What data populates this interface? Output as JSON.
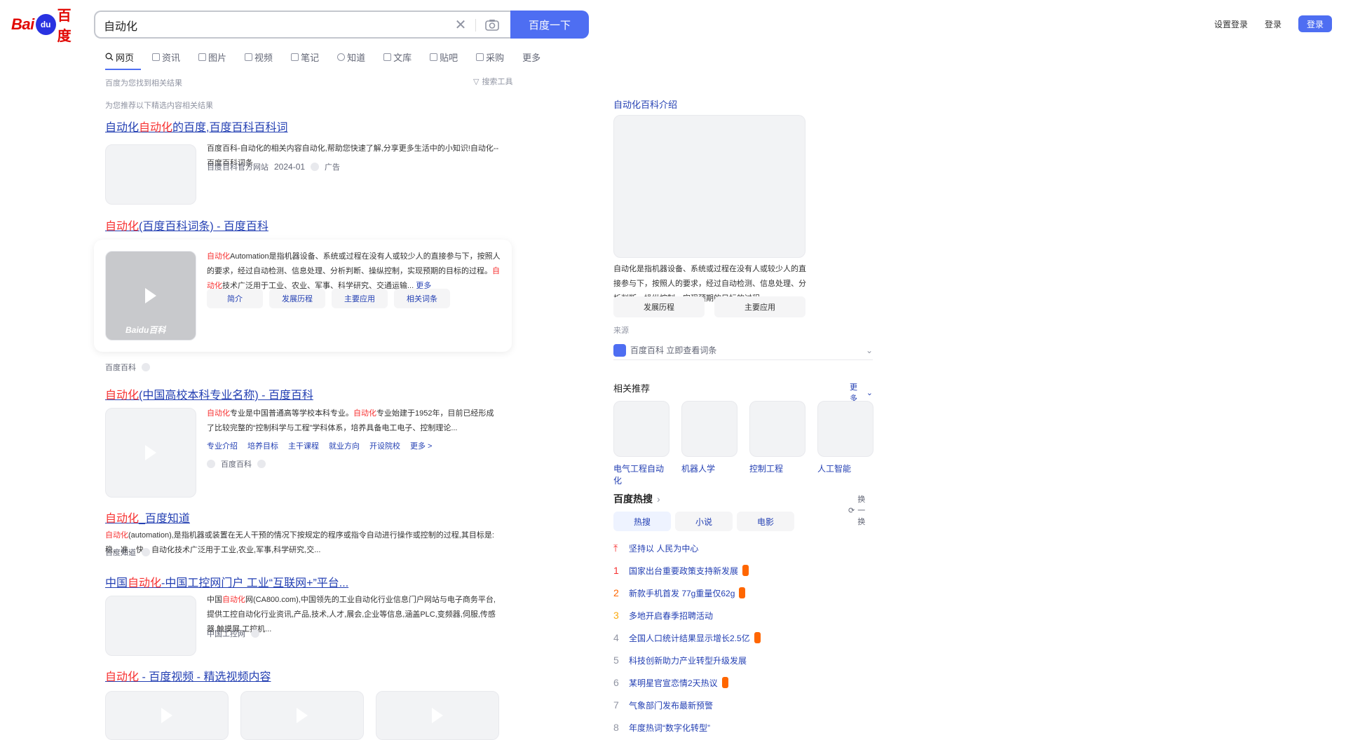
{
  "header": {
    "logo_text_left": "Bai",
    "logo_paw": "du",
    "logo_text_right": "百度",
    "search_value": "自动化",
    "search_button": "百度一下",
    "top_links": [
      "设置登录",
      "登录"
    ],
    "login_button": "登录"
  },
  "tabs": [
    {
      "label": "网页",
      "active": true
    },
    {
      "label": "资讯"
    },
    {
      "label": "图片"
    },
    {
      "label": "视频"
    },
    {
      "label": "笔记"
    },
    {
      "label": "知道"
    },
    {
      "label": "文库"
    },
    {
      "label": "贴吧"
    },
    {
      "label": "采购"
    },
    {
      "label": "更多"
    }
  ],
  "result_count": "百度为您找到相关结果",
  "tools_label": "搜索工具",
  "hint": "为您推荐以下精选内容相关结果",
  "results": {
    "r1": {
      "title_pre": "自动化",
      "title_em": "自动化",
      "title_post": "的百度,百度百科百科词",
      "text": "百度百科-自动化的相关内容自动化,帮助您快速了解,分享更多生活中的小知识!自动化--百度百科词条",
      "source": "百度百科官方网站",
      "date": "2024-01",
      "ad": "广告"
    },
    "r2": {
      "title_em": "自动化",
      "title_post": "(百度百科词条) - 百度百科",
      "text_em": "自动化",
      "text_mid": "Automation",
      "text_rest": "是指机器设备、系统或过程在没有人或较少人的直接参与下，按照人的要求，经过自动检测、信息处理、分析判断、操纵控制，实现预期的目标的过程。",
      "text2_em": "自动化",
      "text2_rest": "技术广泛用于工业、农业、军事、科学研究、交通运输...",
      "more": "更多",
      "buttons": [
        "简介",
        "发展历程",
        "主要应用",
        "相关词条"
      ],
      "source": "百度百科",
      "watermark": "Baidu百科"
    },
    "r3": {
      "title_em": "自动化",
      "title_post": "(中国高校本科专业名称) - 百度百科",
      "text_em": "自动化",
      "text_mid": "专业是中国普通高等学校本科专业。",
      "text2_em": "自动化",
      "text_rest": "专业始建于1952年，目前已经形成了比较完整的“控制科学与工程”学科体系，培养具备电工电子、控制理论...",
      "links": [
        "专业介绍",
        "培养目标",
        "主干课程",
        "就业方向",
        "开设院校",
        "更多 >"
      ],
      "source": "百度百科"
    },
    "r4": {
      "title_em": "自动化",
      "title_post": "_百度知道",
      "text_em": "自动化",
      "text_rest": "(automation),是指机器或装置在无人干预的情况下按规定的程序或指令自动进行操作或控制的过程,其目标是:稳、准、快。自动化技术广泛用于工业,农业,军事,科学研究,交...",
      "source": "百度知道"
    },
    "r5": {
      "title_pre": "中国",
      "title_em": "自动化",
      "title_post": "-中国工控网门户 工业“互联网+”平台...",
      "text_pre": "中国",
      "text_em": "自动化",
      "text_rest": "网(CA800.com),中国领先的工业自动化行业信息门户网站与电子商务平台,提供工控自动化行业资讯,产品,技术,人才,展会,企业等信息,涵盖PLC,变频器,伺服,传感器,触摸屏,工控机...",
      "source": "中国工控网"
    },
    "r6": {
      "title_em": "自动化",
      "title_post": " - 百度视频 - 精选视频内容",
      "source": ""
    }
  },
  "right": {
    "card_title": "自动化百科介绍",
    "card_text": "自动化是指机器设备、系统或过程在没有人或较少人的直接参与下，按照人的要求，经过自动检测、信息处理、分析判断、操纵控制，实现预期的目标的过程...",
    "card_buttons": [
      "发展历程",
      "主要应用"
    ],
    "source_label": "来源",
    "baike_row": "百度百科 立即查看词条",
    "related_title": "相关推荐",
    "related_more": "更多",
    "related": [
      "电气工程自动化",
      "机器人学",
      "控制工程",
      "人工智能"
    ],
    "hot_title": "百度热搜",
    "hot_refresh": "换一换",
    "hot_tabs": [
      "热搜",
      "小说",
      "电影"
    ],
    "hot_items": [
      {
        "rank": "",
        "text": "坚持以 人民为中心",
        "pinned": true,
        "badge": false
      },
      {
        "rank": "1",
        "text": "国家出台重要政策支持新发展",
        "badge": true
      },
      {
        "rank": "2",
        "text": "新款手机首发 77g重量仅62g",
        "badge": true
      },
      {
        "rank": "3",
        "text": "多地开启春季招聘活动",
        "badge": false
      },
      {
        "rank": "4",
        "text": "全国人口统计结果显示增长2.5亿",
        "badge": true
      },
      {
        "rank": "5",
        "text": "科技创新助力产业转型升级发展",
        "badge": false
      },
      {
        "rank": "6",
        "text": "某明星官宣恋情2天热议",
        "badge": true
      },
      {
        "rank": "7",
        "text": "气象部门发布最新预警",
        "badge": false
      },
      {
        "rank": "8",
        "text": "年度热词“数字化转型”",
        "badge": false
      }
    ]
  }
}
